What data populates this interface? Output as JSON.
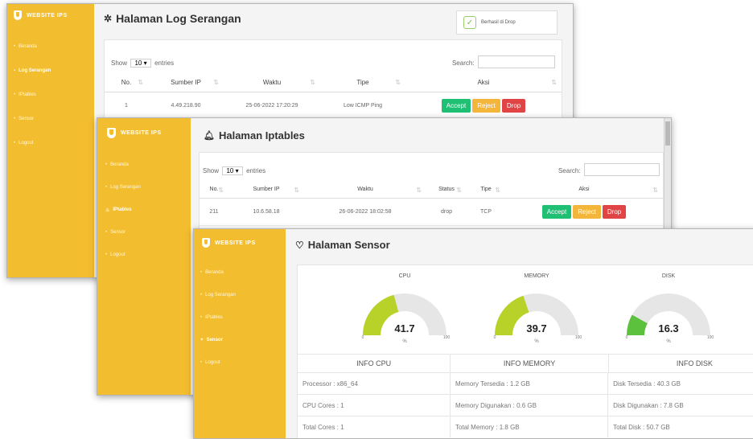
{
  "win1": {
    "brand": "WEBSITE IPS",
    "nav": [
      {
        "label": "Beranda",
        "active": false
      },
      {
        "label": "Log Serangan",
        "active": true
      },
      {
        "label": "IPtables",
        "active": false
      },
      {
        "label": "Sensor",
        "active": false
      },
      {
        "label": "Logout",
        "active": false
      }
    ],
    "title": "Halaman Log Serangan",
    "title_icon": "bug-icon",
    "auto_drop_label": "Berhasil di Drop",
    "show_label": "Show",
    "entries_value": "10",
    "entries_label": "entries",
    "search_label": "Search:",
    "columns": [
      "No.",
      "Sumber IP",
      "Waktu",
      "Tipe",
      "Aksi"
    ],
    "rows": [
      {
        "no": "1",
        "ip": "4.49.218.90",
        "time": "25-06-2022 17:20:29",
        "type": "Low ICMP Ping"
      }
    ],
    "actions": {
      "accept": "Accept",
      "reject": "Reject",
      "drop": "Drop"
    }
  },
  "win2": {
    "brand": "WEBSITE IPS",
    "nav": [
      {
        "label": "Beranda",
        "active": false
      },
      {
        "label": "Log Serangan",
        "active": false
      },
      {
        "label": "IPtables",
        "active": true
      },
      {
        "label": "Sensor",
        "active": false
      },
      {
        "label": "Logout",
        "active": false
      }
    ],
    "title": "Halaman Iptables",
    "title_icon": "bell-icon",
    "show_label": "Show",
    "entries_value": "10",
    "entries_label": "entries",
    "search_label": "Search:",
    "columns": [
      "No.",
      "Sumber IP",
      "Waktu",
      "Status",
      "Tipe",
      "Aksi"
    ],
    "rows": [
      {
        "no": "211",
        "ip": "10.6.58.18",
        "time": "26-06-2022 18:02:58",
        "status": "drop",
        "type": "TCP"
      }
    ],
    "actions": {
      "accept": "Accept",
      "reject": "Reject",
      "drop": "Drop"
    }
  },
  "win3": {
    "brand": "WEBSITE IPS",
    "nav": [
      {
        "label": "Beranda",
        "active": false
      },
      {
        "label": "Log Serangan",
        "active": false
      },
      {
        "label": "IPtables",
        "active": false
      },
      {
        "label": "Sensor",
        "active": true
      },
      {
        "label": "Logout",
        "active": false
      }
    ],
    "title": "Halaman Sensor",
    "title_icon": "heartbeat-icon",
    "gauges": [
      {
        "label": "CPU",
        "value": 41.7,
        "display": "41.7",
        "min": "0",
        "max": "100",
        "unit": "%",
        "color": "#b9d22a"
      },
      {
        "label": "MEMORY",
        "value": 39.7,
        "display": "39.7",
        "min": "0",
        "max": "100",
        "unit": "%",
        "color": "#b9d22a"
      },
      {
        "label": "DISK",
        "value": 16.3,
        "display": "16.3",
        "min": "0",
        "max": "100",
        "unit": "%",
        "color": "#5cc13d"
      }
    ],
    "info_headers": [
      "INFO CPU",
      "INFO MEMORY",
      "INFO DISK"
    ],
    "info_rows": [
      [
        "Processor : x86_64",
        "Memory Tersedia : 1.2 GB",
        "Disk Tersedia : 40.3 GB"
      ],
      [
        "CPU Cores : 1",
        "Memory Digunakan : 0.6 GB",
        "Disk Digunakan : 7.8 GB"
      ],
      [
        "Total Cores : 1",
        "Total Memory : 1.8 GB",
        "Total Disk : 50.7 GB"
      ]
    ]
  },
  "colors": {
    "sidebar": "#f2bd2f",
    "accept": "#1fbf74",
    "reject": "#f4b63a",
    "drop": "#e04444",
    "gauge_track": "#e6e6e6"
  }
}
